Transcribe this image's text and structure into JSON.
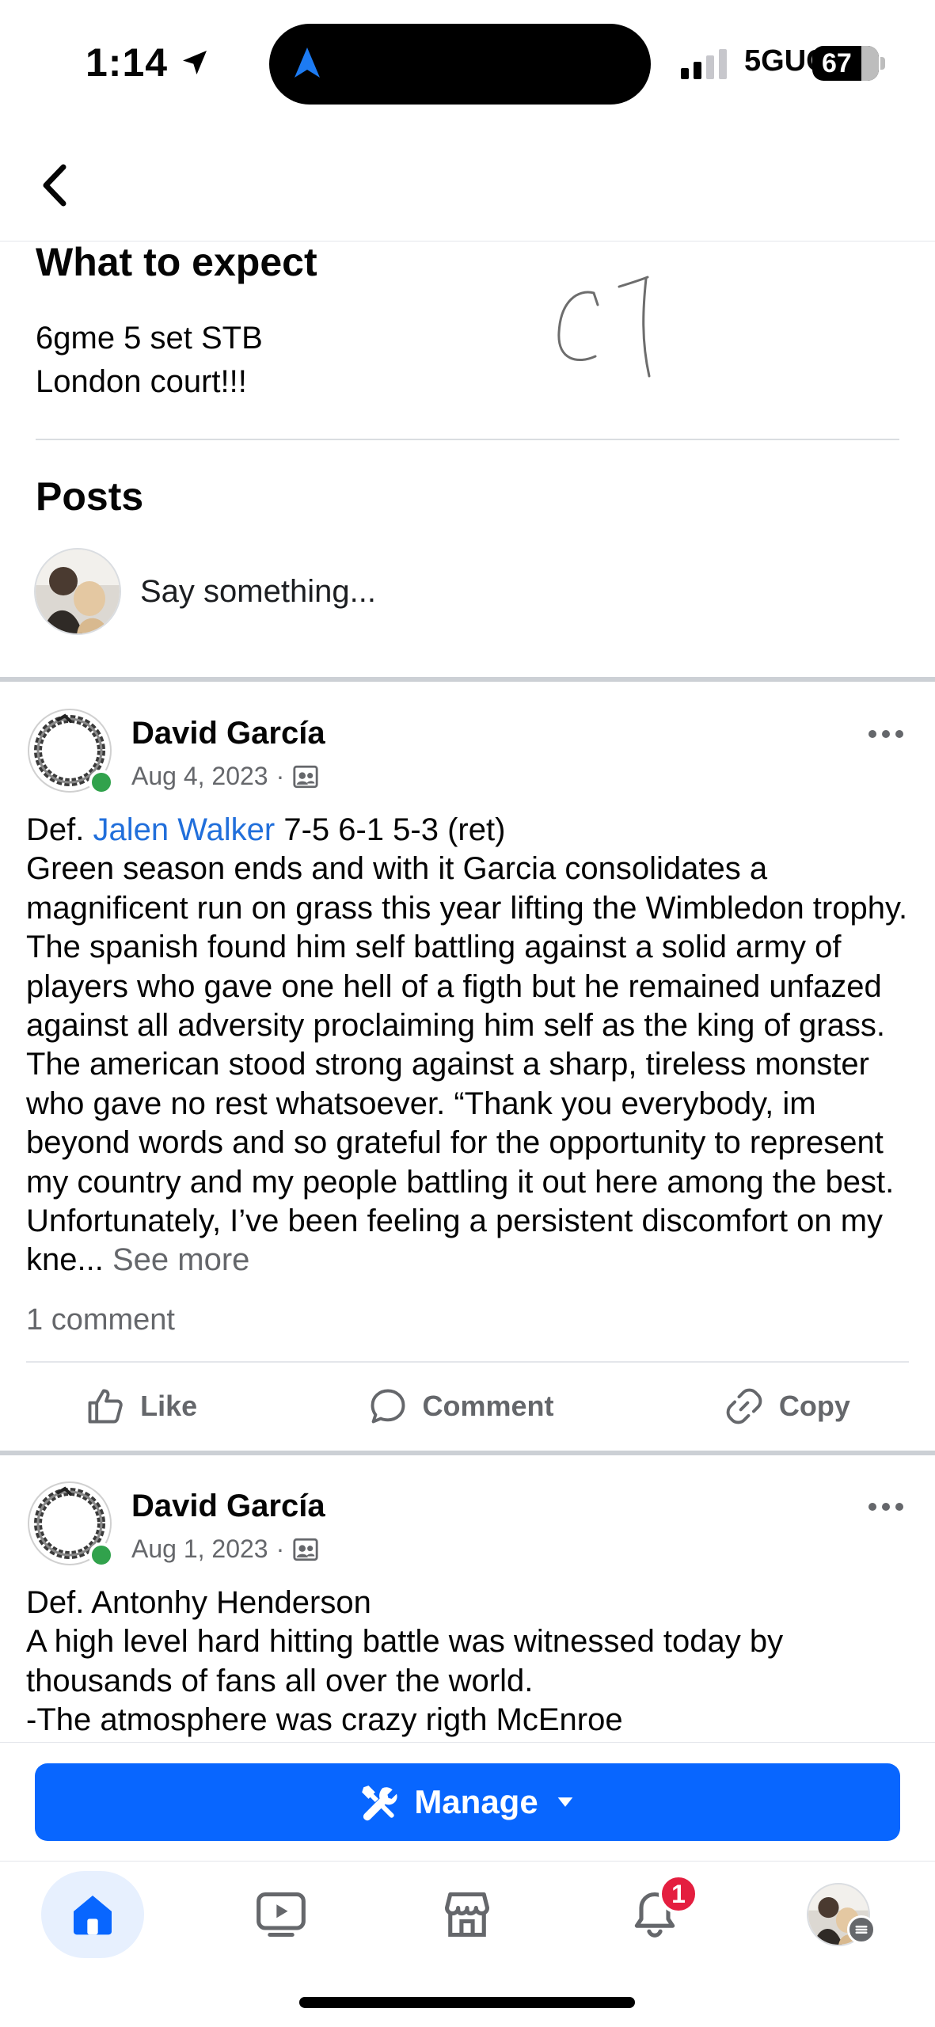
{
  "status_bar": {
    "time": "1:14",
    "network": "5GUC",
    "battery": "67",
    "signal_bars": 2
  },
  "event": {
    "expect_title": "What to expect",
    "expect_lines": [
      "6gme 5 set STB",
      "London court!!!"
    ],
    "handwritten_note": "C1",
    "posts_title": "Posts",
    "composer_placeholder": "Say something..."
  },
  "posts": [
    {
      "author": "David García",
      "date": "Aug 4, 2023",
      "line1_prefix": "Def. ",
      "line1_link": "Jalen Walker",
      "line1_suffix": " 7-5 6-1 5-3 (ret)",
      "text": "Green season ends and with it Garcia consolidates a magnificent run on grass this year lifting the Wimbledon trophy. The spanish found him self battling against a solid army of players who gave one hell of a figth but he remained unfazed against all adversity proclaiming him self as the king of grass. The american stood strong against a sharp, tireless monster who gave no rest whatsoever. “Thank you everybody, im beyond words and so grateful for the opportunity to represent my country and my people battling it out here among the best. Unfortunately, I’ve been feeling a persistent discomfort on my kne...",
      "see_more": "See more",
      "comment_count": "1 comment",
      "actions": {
        "like": "Like",
        "comment": "Comment",
        "copy": "Copy"
      }
    },
    {
      "author": "David García",
      "date": "Aug 1, 2023",
      "line1": "Def. Antonhy Henderson",
      "text_lines": [
        "A high level hard hitting battle was witnessed today by",
        "thousands of fans all over the world.",
        "-The atmosphere was crazy rigth McEnroe"
      ]
    }
  ],
  "manage_button": "Manage",
  "bottom_nav": {
    "tabs": [
      "home-icon",
      "video-icon",
      "marketplace-icon",
      "notifications-icon",
      "profile-icon"
    ],
    "notification_badge": "1"
  },
  "colors": {
    "accent": "#0866ff",
    "link": "#216fdb",
    "badge": "#e41e3f",
    "online": "#31a24c"
  }
}
